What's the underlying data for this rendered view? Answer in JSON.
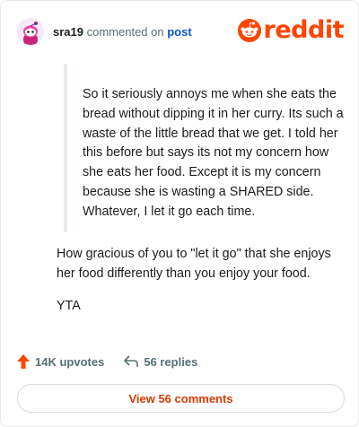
{
  "header": {
    "username": "sra19",
    "commented_on_text": "commented on",
    "post_link": "post",
    "logo_text": "reddit"
  },
  "quote": {
    "text": "So it seriously annoys me when she eats the bread without dipping it in her curry. Its such a waste of the little bread that we get. I told her this before but says its not my concern how she eats her food. Except it is my concern because she is wasting a SHARED side. Whatever, I let it go each time."
  },
  "comment": {
    "paragraphs": [
      "How gracious of you to \"let it go\" that she enjoys her food differently than you enjoy your food.",
      "YTA"
    ]
  },
  "actions": {
    "upvotes": "14K upvotes",
    "replies": "56 replies"
  },
  "view_button": "View 56 comments",
  "colors": {
    "brand": "#ff4500",
    "link": "#0a54d3",
    "button_text": "#d93a00"
  }
}
